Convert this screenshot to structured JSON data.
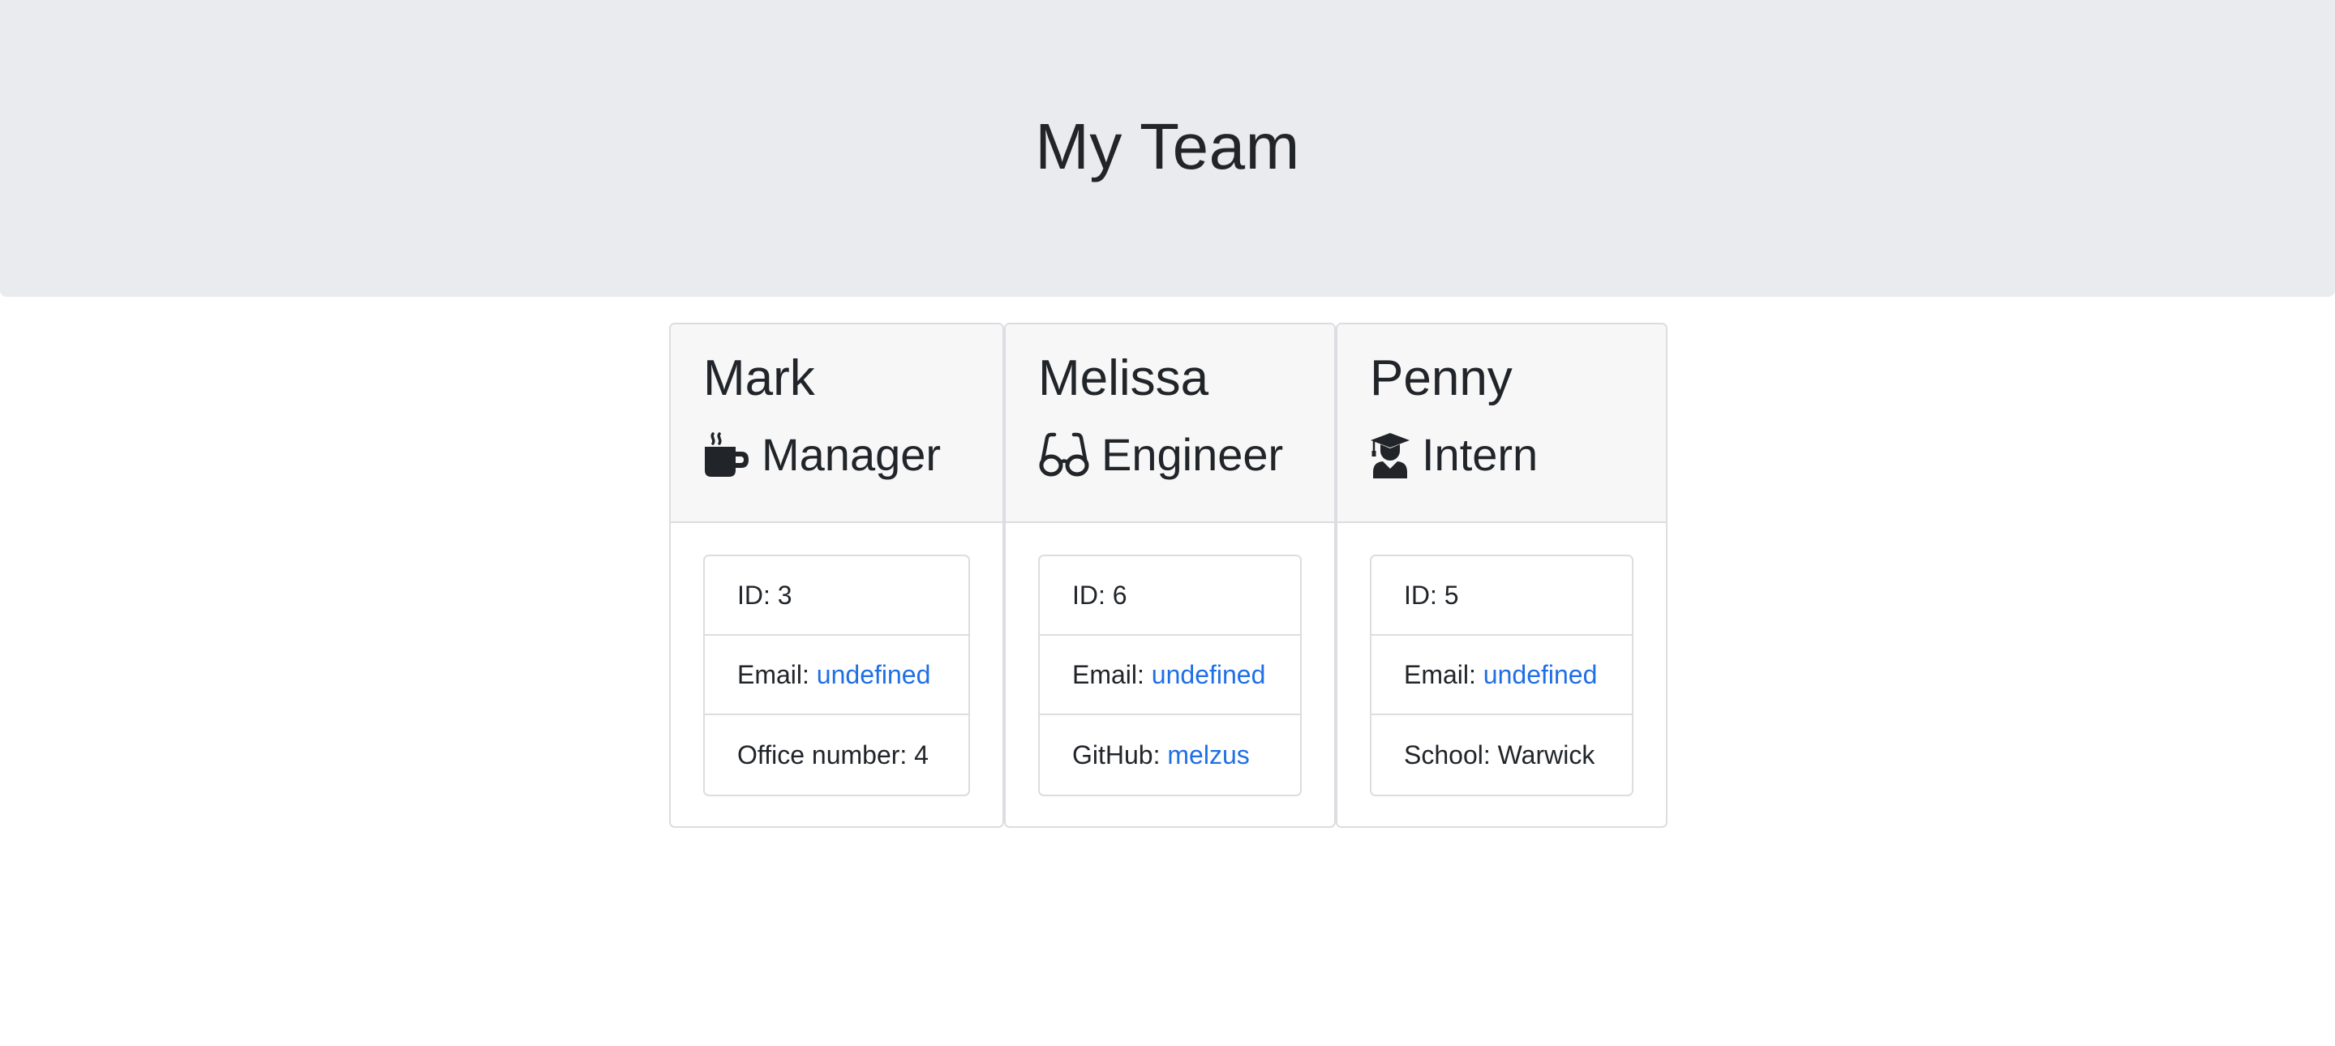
{
  "header": {
    "title": "My Team"
  },
  "employees": [
    {
      "name": "Mark",
      "role": "Manager",
      "icon": "mug-icon",
      "id_text": "ID: 3",
      "email_label": "Email:",
      "email_value": "undefined",
      "extra_label": "Office number: 4",
      "extra_value": ""
    },
    {
      "name": "Melissa",
      "role": "Engineer",
      "icon": "glasses-icon",
      "id_text": "ID: 6",
      "email_label": "Email:",
      "email_value": "undefined",
      "extra_label": "GitHub:",
      "extra_value": "melzus"
    },
    {
      "name": "Penny",
      "role": "Intern",
      "icon": "graduate-icon",
      "id_text": "ID: 5",
      "email_label": "Email:",
      "email_value": "undefined",
      "extra_label": "School: Warwick",
      "extra_value": ""
    }
  ],
  "colors": {
    "jumbotron_bg": "#eaebee",
    "card_header_bg": "#f7f7f7",
    "border": "#dcdde0",
    "link": "#1f6fe5",
    "text": "#212529"
  }
}
